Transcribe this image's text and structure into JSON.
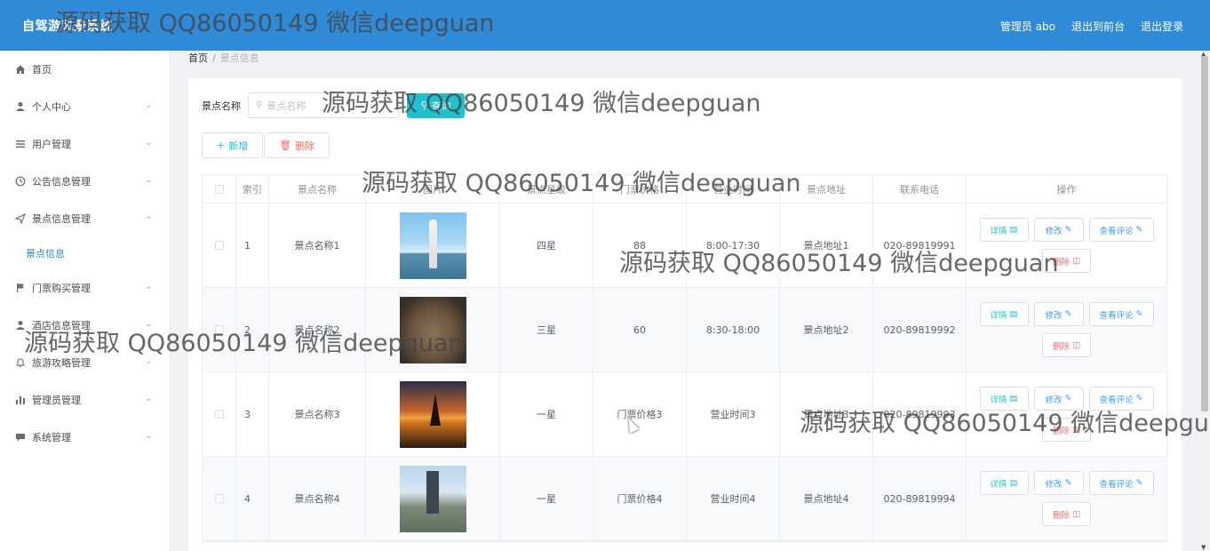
{
  "app": {
    "title": "自驾游风景系统"
  },
  "header": {
    "admin": "管理员 abo",
    "to_front": "退出到前台",
    "logout": "退出登录"
  },
  "sidebar": {
    "items": [
      {
        "label": "首页",
        "icon": "home-icon",
        "expandable": false
      },
      {
        "label": "个人中心",
        "icon": "user-icon",
        "expandable": true
      },
      {
        "label": "用户管理",
        "icon": "list-icon",
        "expandable": true
      },
      {
        "label": "公告信息管理",
        "icon": "clock-icon",
        "expandable": true
      },
      {
        "label": "景点信息管理",
        "icon": "send-icon",
        "expandable": true,
        "expanded": true
      },
      {
        "label": "门票购买管理",
        "icon": "flag-icon",
        "expandable": true
      },
      {
        "label": "酒店信息管理",
        "icon": "user-icon",
        "expandable": true
      },
      {
        "label": "旅游攻略管理",
        "icon": "bell-icon",
        "expandable": true
      },
      {
        "label": "管理员管理",
        "icon": "bar-chart-icon",
        "expandable": true
      },
      {
        "label": "系统管理",
        "icon": "chat-icon",
        "expandable": true
      }
    ],
    "sub_item": "景点信息"
  },
  "breadcrumb": {
    "home": "首页",
    "sep": "/",
    "current": "景点信息"
  },
  "search": {
    "label": "景点名称",
    "placeholder": "景点名称",
    "button": "查询"
  },
  "actions": {
    "add": "新增",
    "delete": "删除"
  },
  "table": {
    "headers": [
      "",
      "索引",
      "景点名称",
      "图片",
      "景点星级",
      "门票价格",
      "营业时间",
      "景点地址",
      "联系电话",
      "操作"
    ],
    "rows": [
      {
        "index": "1",
        "name": "景点名称1",
        "star": "四星",
        "price": "88",
        "hours": "8:00-17:30",
        "address": "景点地址1",
        "phone": "020-89819991"
      },
      {
        "index": "2",
        "name": "景点名称2",
        "star": "三星",
        "price": "60",
        "hours": "8:30-18:00",
        "address": "景点地址2",
        "phone": "020-89819992"
      },
      {
        "index": "3",
        "name": "景点名称3",
        "star": "一星",
        "price": "门票价格3",
        "hours": "营业时间3",
        "address": "景点地址3",
        "phone": "020-89819993"
      },
      {
        "index": "4",
        "name": "景点名称4",
        "star": "一星",
        "price": "门票价格4",
        "hours": "营业时间4",
        "address": "景点地址4",
        "phone": "020-89819994"
      }
    ],
    "ops": {
      "detail": "详情",
      "edit": "修改",
      "comment": "查看评论",
      "remove": "删除"
    }
  },
  "watermark": "源码获取 QQ86050149 微信deepguan"
}
